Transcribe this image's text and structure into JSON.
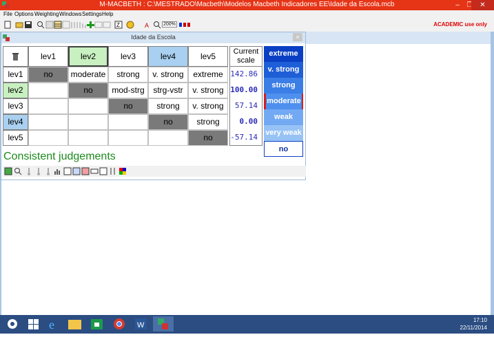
{
  "window": {
    "title": "M-MACBETH : C:\\MESTRADO\\Macbeth\\Modelos Macbeth Indicadores EE\\Idade da Escola.mcb",
    "minimize": "–",
    "restore": "❐",
    "close": "✕"
  },
  "menu": [
    "File",
    "Options",
    "Weighting",
    "Windows",
    "Settings",
    "Help"
  ],
  "toolbar": {
    "zoom": "200%",
    "license": "ACADEMIC use only"
  },
  "child_window": {
    "title": "Idade da Escola",
    "close": "×"
  },
  "matrix": {
    "columns": [
      "lev1",
      "lev2",
      "lev3",
      "lev4",
      "lev5"
    ],
    "current_scale_header": "Current scale",
    "rows": [
      {
        "label": "lev1",
        "cells": [
          "no",
          "moderate",
          "strong",
          "v. strong",
          "extreme"
        ],
        "scale": "142.86"
      },
      {
        "label": "lev2",
        "cells": [
          "",
          "no",
          "mod-strg",
          "strg-vstr",
          "v. strong"
        ],
        "scale": "100.00"
      },
      {
        "label": "lev3",
        "cells": [
          "",
          "",
          "no",
          "strong",
          "v. strong"
        ],
        "scale": "57.14"
      },
      {
        "label": "lev4",
        "cells": [
          "",
          "",
          "",
          "no",
          "strong"
        ],
        "scale": "0.00"
      },
      {
        "label": "lev5",
        "cells": [
          "",
          "",
          "",
          "",
          "no"
        ],
        "scale": "-57.14"
      }
    ]
  },
  "judgement_levels": [
    "extreme",
    "v. strong",
    "strong",
    "moderate",
    "weak",
    "very weak",
    "no"
  ],
  "status": "Consistent judgements",
  "taskbar": {
    "time": "17:10",
    "date": "22/11/2014"
  }
}
